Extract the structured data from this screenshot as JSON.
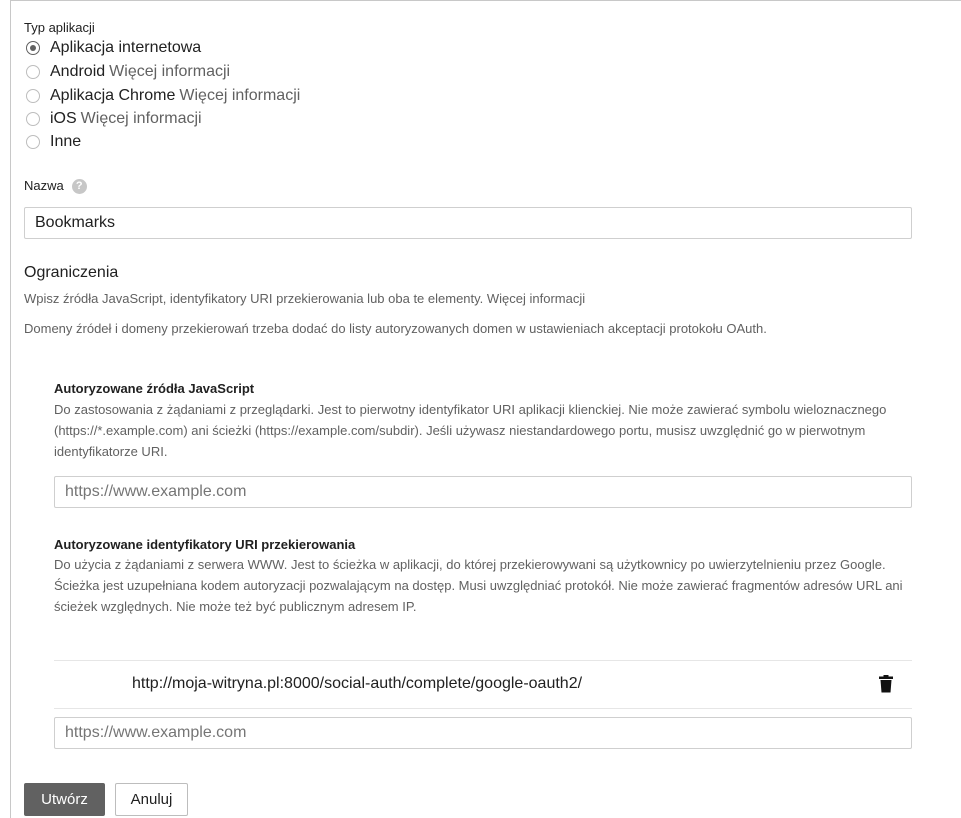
{
  "app_type": {
    "label": "Typ aplikacji",
    "options": [
      {
        "label": "Aplikacja internetowa",
        "more": "",
        "checked": true
      },
      {
        "label": "Android",
        "more": "Więcej informacji",
        "checked": false
      },
      {
        "label": "Aplikacja Chrome",
        "more": "Więcej informacji",
        "checked": false
      },
      {
        "label": "iOS",
        "more": "Więcej informacji",
        "checked": false
      },
      {
        "label": "Inne",
        "more": "",
        "checked": false
      }
    ]
  },
  "name": {
    "label": "Nazwa",
    "help_icon": "help-circle-icon",
    "help_glyph": "?",
    "value": "Bookmarks"
  },
  "restrictions": {
    "heading": "Ograniczenia",
    "line1": "Wpisz źródła JavaScript, identyfikatory URI przekierowania lub oba te elementy. Więcej informacji",
    "line2": "Domeny źródeł i domeny przekierowań trzeba dodać do listy autoryzowanych domen w ustawieniach akceptacji protokołu OAuth."
  },
  "js_origins": {
    "title": "Autoryzowane źródła JavaScript",
    "description": "Do zastosowania z żądaniami z przeglądarki. Jest to pierwotny identyfikator URI aplikacji klienckiej. Nie może zawierać symbolu wieloznacznego (https://*.example.com) ani ścieżki (https://example.com/subdir). Jeśli używasz niestandardowego portu, musisz uwzględnić go w pierwotnym identyfikatorze URI.",
    "placeholder": "https://www.example.com"
  },
  "redirect_uris": {
    "title": "Autoryzowane identyfikatory URI przekierowania",
    "description": "Do użycia z żądaniami z serwera WWW. Jest to ścieżka w aplikacji, do której przekierowywani są użytkownicy po uwierzytelnieniu przez Google. Ścieżka jest uzupełniana kodem autoryzacji pozwalającym na dostęp. Musi uwzględniać protokół. Nie może zawierać fragmentów adresów URL ani ścieżek względnych. Nie może też być publicznym adresem IP.",
    "entries": [
      "http://moja-witryna.pl:8000/social-auth/complete/google-oauth2/"
    ],
    "delete_icon": "trash-icon",
    "placeholder": "https://www.example.com"
  },
  "actions": {
    "create": "Utwórz",
    "cancel": "Anuluj"
  },
  "colors": {
    "primary_button": "#616161",
    "secondary_text": "#616161"
  }
}
